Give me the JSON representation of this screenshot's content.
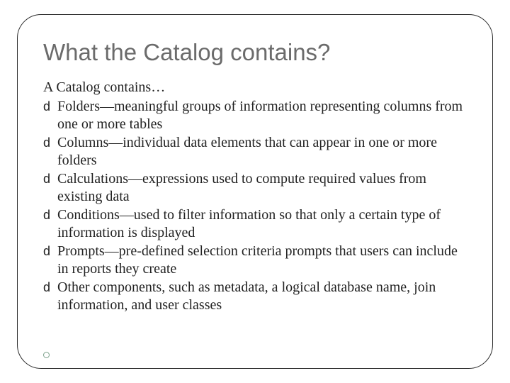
{
  "title": "What the Catalog contains?",
  "intro": "A Catalog contains…",
  "bullet_glyph": "d",
  "bullets": [
    "Folders—meaningful groups of information representing columns from one or more tables",
    "Columns—individual data elements that can appear in one or more folders",
    "Calculations—expressions used to compute required values from existing data",
    "Conditions—used to filter information so that only a certain type of information is displayed",
    "Prompts—pre-defined selection criteria prompts that users can include in reports they create",
    "Other components, such as metadata, a logical database name, join information, and user classes"
  ]
}
